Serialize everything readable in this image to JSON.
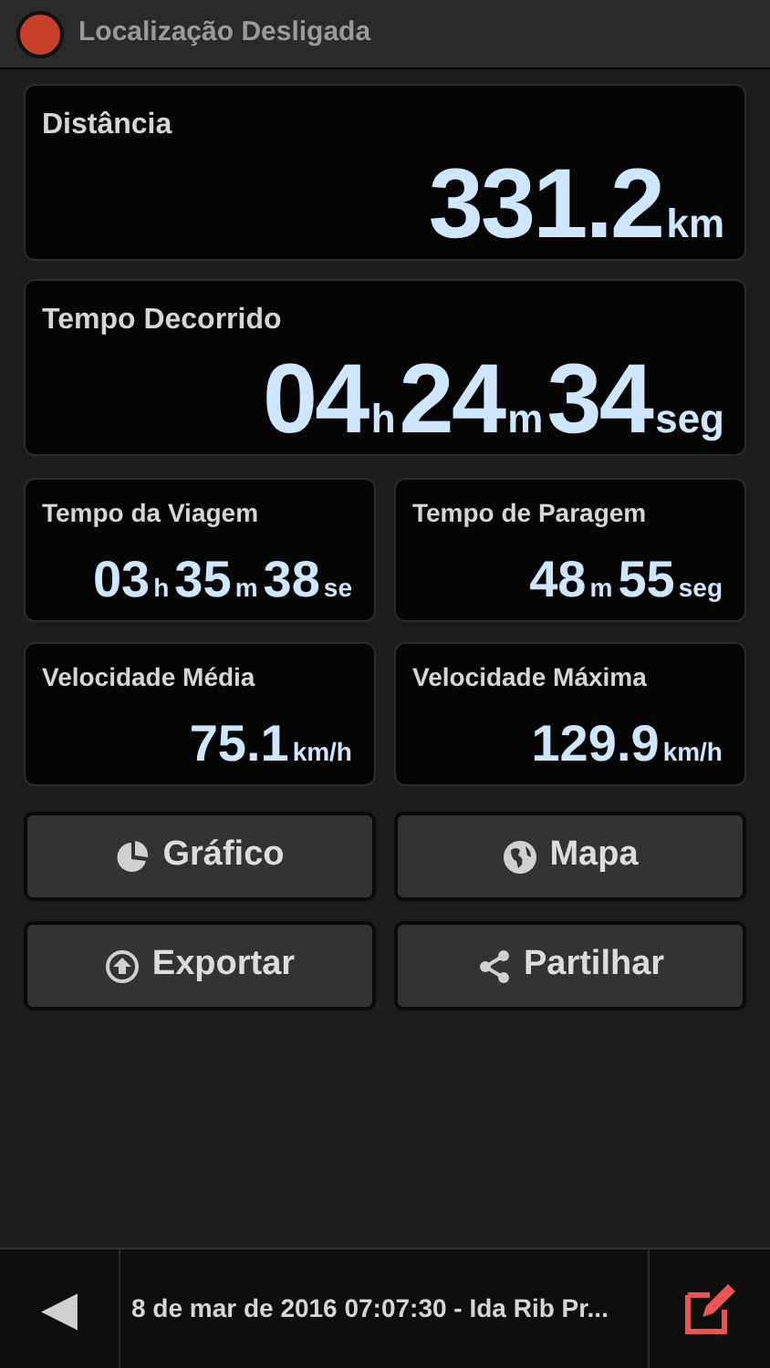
{
  "status": {
    "location_on": false,
    "label": "Localização Desligada"
  },
  "wide_cards": [
    {
      "title": "Distância",
      "value": [
        {
          "number": "331.2",
          "unit": "km"
        }
      ]
    },
    {
      "title": "Tempo Decorrido",
      "value": [
        {
          "number": "04",
          "unit": "h"
        },
        {
          "number": "24",
          "unit": "m"
        },
        {
          "number": "34",
          "unit": "seg"
        }
      ]
    }
  ],
  "small_cards": [
    {
      "title": "Tempo da Viagem",
      "value": [
        {
          "number": "03",
          "unit": "h"
        },
        {
          "number": "35",
          "unit": "m"
        },
        {
          "number": "38",
          "unit": "se"
        }
      ]
    },
    {
      "title": "Tempo de Paragem",
      "value": [
        {
          "number": "48",
          "unit": "m"
        },
        {
          "number": "55",
          "unit": "seg"
        }
      ]
    },
    {
      "title": "Velocidade Média",
      "value": [
        {
          "number": "75.1",
          "unit": "km/h"
        }
      ]
    },
    {
      "title": "Velocidade Máxima",
      "value": [
        {
          "number": "129.9",
          "unit": "km/h"
        }
      ]
    }
  ],
  "buttons": [
    {
      "kind": "chart",
      "label": "Gráfico"
    },
    {
      "kind": "map",
      "label": "Mapa"
    },
    {
      "kind": "export",
      "label": "Exportar"
    },
    {
      "kind": "share",
      "label": "Partilhar"
    }
  ],
  "bottom_bar": {
    "back": "◀",
    "title": "8 de mar de 2016 07:07:30 - Ida Rib Pr..."
  }
}
